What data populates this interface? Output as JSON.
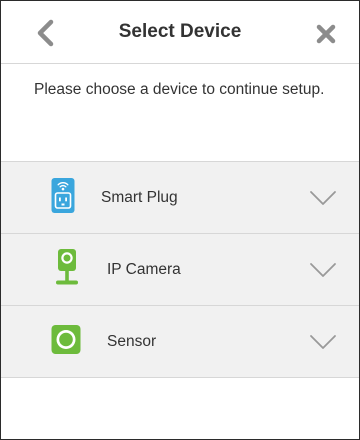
{
  "header": {
    "title": "Select Device",
    "back_icon": "chevron-left-icon",
    "close_icon": "close-icon"
  },
  "instruction": "Please choose a device to continue setup.",
  "devices": [
    {
      "label": "Smart Plug",
      "icon": "smart-plug-icon",
      "color": "#3aa6dd"
    },
    {
      "label": "IP Camera",
      "icon": "ip-camera-icon",
      "color": "#6dbb3c"
    },
    {
      "label": "Sensor",
      "icon": "sensor-icon",
      "color": "#6dbb3c"
    }
  ],
  "colors": {
    "text": "#333333",
    "icon_gray": "#8c8c8c",
    "list_bg": "#f1f1f1",
    "divider": "#d7d7d7",
    "chevron": "#999999"
  }
}
